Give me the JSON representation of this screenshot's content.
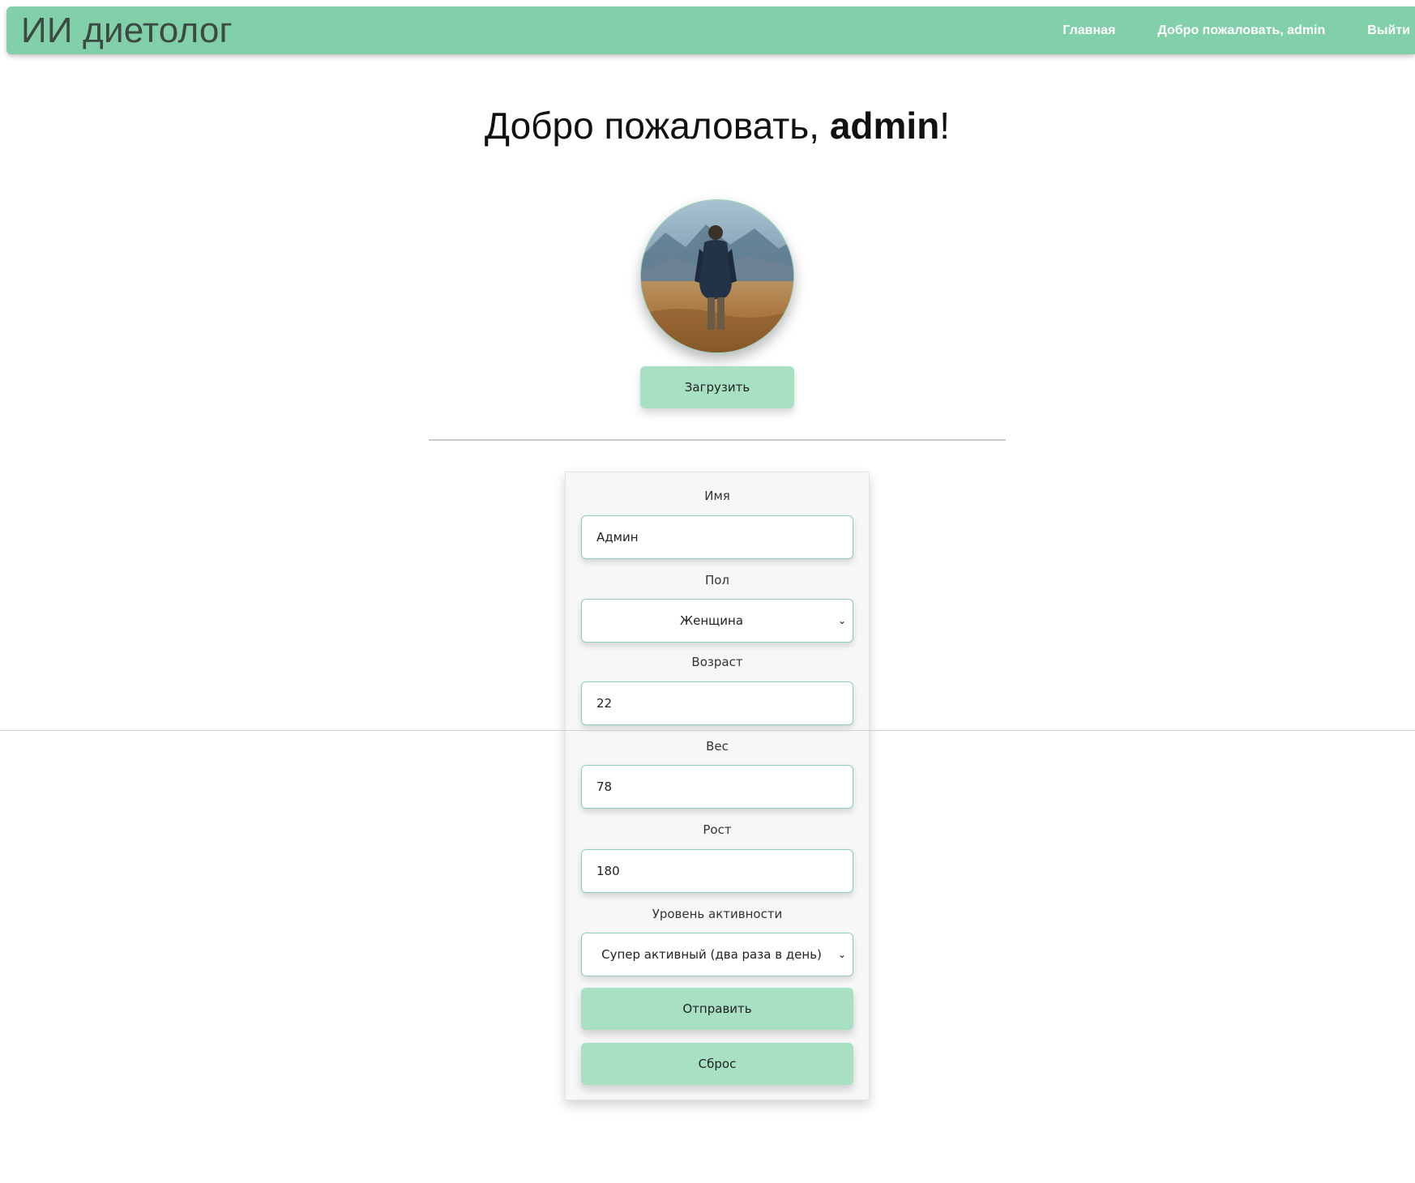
{
  "navbar": {
    "brand": "ИИ диетолог",
    "links": [
      "Главная",
      "Добро пожаловать, admin",
      "Выйти"
    ]
  },
  "welcome": {
    "prefix": "Добро пожаловать, ",
    "username": "admin",
    "suffix": "!"
  },
  "avatar": {
    "icon": "profile-photo"
  },
  "upload_label": "Загрузить",
  "form": {
    "name_label": "Имя",
    "name_value": "Админ",
    "gender_label": "Пол",
    "gender_value": "Женщина",
    "age_label": "Возраст",
    "age_value": "22",
    "weight_label": "Вес",
    "weight_value": "78",
    "height_label": "Рост",
    "height_value": "180",
    "activity_label": "Уровень активности",
    "activity_value": "Супер активный (два раза в день)",
    "submit_label": "Отправить",
    "reset_label": "Сброс"
  },
  "colors": {
    "navbar_bg": "#82d0a9",
    "button_bg": "#a8e0c4",
    "field_border": "#8fd0b0"
  }
}
